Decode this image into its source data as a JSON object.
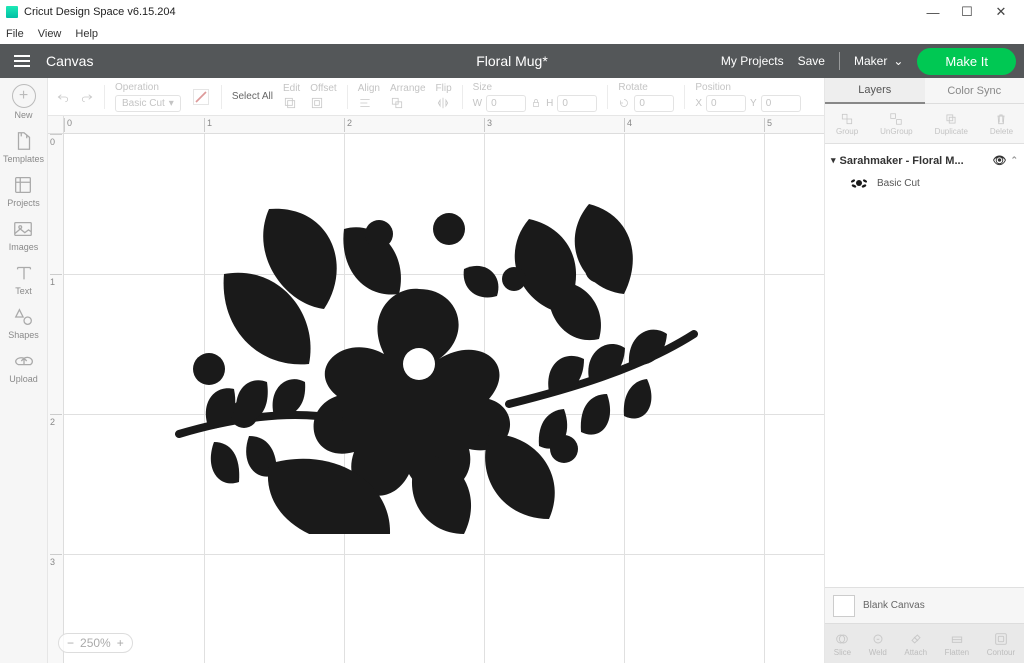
{
  "window": {
    "title": "Cricut Design Space  v6.15.204"
  },
  "menubar": {
    "file": "File",
    "view": "View",
    "help": "Help"
  },
  "topbar": {
    "canvas": "Canvas",
    "project_title": "Floral Mug*",
    "my_projects": "My Projects",
    "save": "Save",
    "machine": "Maker",
    "make_it": "Make It"
  },
  "leftrail": {
    "new": "New",
    "templates": "Templates",
    "projects": "Projects",
    "images": "Images",
    "text": "Text",
    "shapes": "Shapes",
    "upload": "Upload"
  },
  "toolbar": {
    "operation_label": "Operation",
    "operation_value": "Basic Cut",
    "select_all": "Select All",
    "edit_label": "Edit",
    "offset_label": "Offset",
    "align_label": "Align",
    "arrange_label": "Arrange",
    "flip_label": "Flip",
    "size_label": "Size",
    "size_w": "W",
    "size_w_val": "0",
    "size_h": "H",
    "size_h_val": "0",
    "rotate_label": "Rotate",
    "rotate_val": "0",
    "position_label": "Position",
    "pos_x": "X",
    "pos_x_val": "0",
    "pos_y": "Y",
    "pos_y_val": "0"
  },
  "ruler": {
    "h": [
      "0",
      "1",
      "2",
      "3",
      "4",
      "5"
    ],
    "v": [
      "0",
      "1",
      "2",
      "3"
    ]
  },
  "zoom": {
    "value": "250%"
  },
  "panels": {
    "layers_tab": "Layers",
    "colorsync_tab": "Color Sync",
    "actions": {
      "group": "Group",
      "ungroup": "UnGroup",
      "duplicate": "Duplicate",
      "delete": "Delete"
    },
    "layer_group_name": "Sarahmaker - Floral M...",
    "layer_item_type": "Basic Cut",
    "blank_canvas": "Blank Canvas",
    "bottom": {
      "slice": "Slice",
      "weld": "Weld",
      "attach": "Attach",
      "flatten": "Flatten",
      "contour": "Contour"
    }
  }
}
